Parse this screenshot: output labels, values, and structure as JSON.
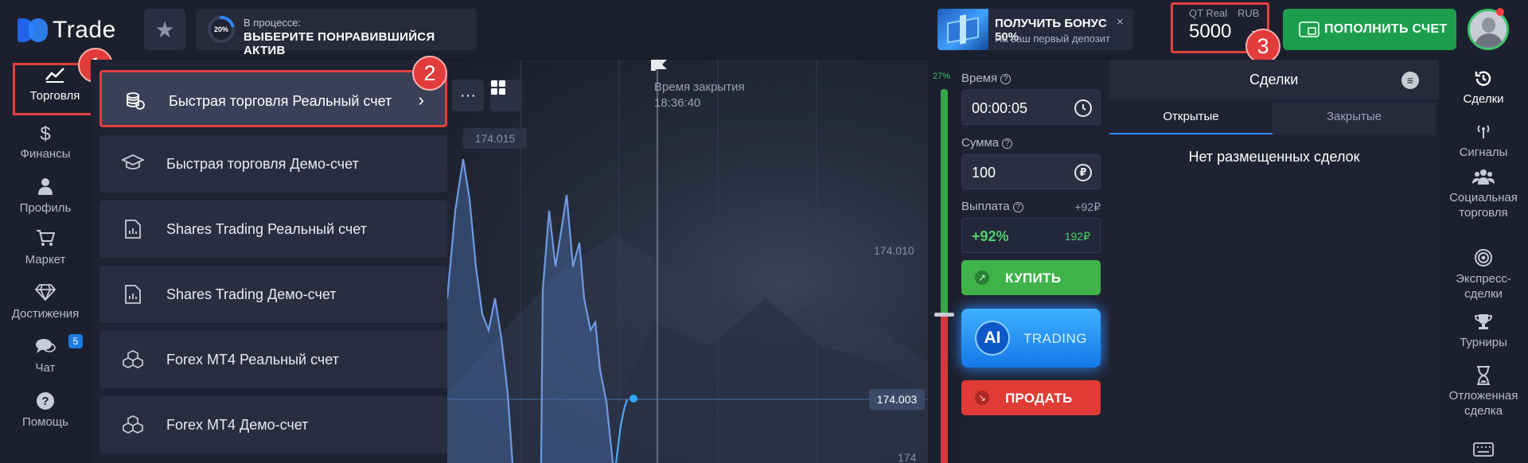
{
  "header": {
    "logo_text": "Trade",
    "progress": {
      "percent_label": "20%",
      "percent": 20,
      "status": "В процессе:",
      "task": "ВЫБЕРИТЕ ПОНРАВИВШИЙСЯ АКТИВ"
    },
    "bonus": {
      "title": "ПОЛУЧИТЬ БОНУС 50%",
      "subtitle": "На ваш первый депозит",
      "close": "×"
    },
    "balance": {
      "account": "QT Real",
      "currency": "RUB",
      "amount": "5000"
    },
    "deposit_label": "ПОПОЛНИТЬ СЧЕТ",
    "annotations": {
      "n1": "1",
      "n2": "2",
      "n3": "3"
    }
  },
  "left_nav": [
    {
      "id": "trade",
      "label": "Торговля",
      "icon": "chart-line-icon"
    },
    {
      "id": "finance",
      "label": "Финансы",
      "icon": "dollar-icon"
    },
    {
      "id": "profile",
      "label": "Профиль",
      "icon": "user-icon"
    },
    {
      "id": "market",
      "label": "Маркет",
      "icon": "cart-icon"
    },
    {
      "id": "achievements",
      "label": "Достижения",
      "icon": "diamond-icon"
    },
    {
      "id": "chat",
      "label": "Чат",
      "icon": "chat-icon",
      "badge": "5"
    },
    {
      "id": "help",
      "label": "Помощь",
      "icon": "help-icon"
    }
  ],
  "accounts": [
    {
      "label": "Быстрая торговля Реальный счет",
      "icon": "coins-icon",
      "active": true
    },
    {
      "label": "Быстрая торговля Демо-счет",
      "icon": "graduation-cap-icon"
    },
    {
      "label": "Shares Trading Реальный счет",
      "icon": "document-chart-icon"
    },
    {
      "label": "Shares Trading Демо-счет",
      "icon": "document-chart-icon"
    },
    {
      "label": "Forex MT4 Реальный счет",
      "icon": "cubes-icon"
    },
    {
      "label": "Forex MT4 Демо-счет",
      "icon": "cubes-icon"
    }
  ],
  "chart": {
    "close_time_label": "Время закрытия",
    "close_time": "18:36:40",
    "high_price": "174.015",
    "price_levels": [
      "174.010",
      "174"
    ],
    "current_price": "174.003",
    "volume_pct": "27%",
    "volume_pct_value": 27
  },
  "trade_panel": {
    "time_label": "Время",
    "time_value": "00:00:05",
    "amount_label": "Сумма",
    "amount_value": "100",
    "payout_label": "Выплата",
    "payout_pct_small": "+92₽",
    "payout_pct": "+92%",
    "payout_amount": "192₽",
    "buy_label": "КУПИТЬ",
    "ai_label": "AI",
    "ai_trading": "TRADING",
    "sell_label": "ПРОДАТЬ"
  },
  "deals": {
    "title": "Сделки",
    "tab_open": "Открытые",
    "tab_closed": "Закрытые",
    "empty": "Нет размещенных сделок"
  },
  "right_nav": [
    {
      "id": "deals",
      "label": "Сделки",
      "icon": "history-icon"
    },
    {
      "id": "signals",
      "label": "Сигналы",
      "icon": "signal-icon"
    },
    {
      "id": "social",
      "label": "Социальная торговля",
      "icon": "group-icon"
    },
    {
      "id": "express",
      "label": "Экспресс-сделки",
      "icon": "target-icon"
    },
    {
      "id": "tournaments",
      "label": "Турниры",
      "icon": "trophy-icon"
    },
    {
      "id": "pending",
      "label": "Отложенная сделка",
      "icon": "hourglass-icon"
    }
  ],
  "colors": {
    "buy": "#3fb34a",
    "sell": "#e03b34",
    "accent": "#2f86ff",
    "annotation": "#e34040"
  }
}
